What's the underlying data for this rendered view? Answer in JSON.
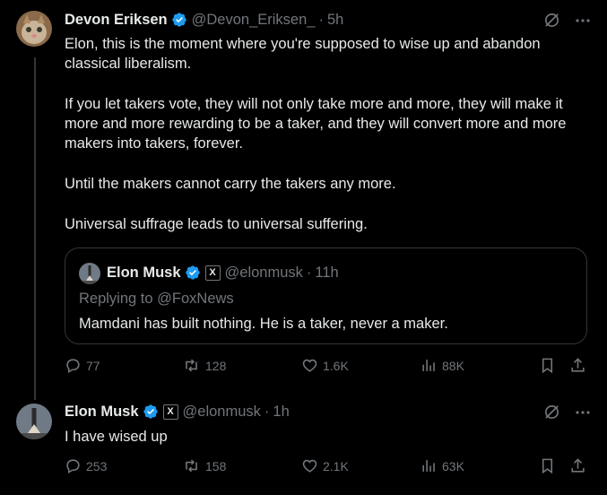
{
  "tweet1": {
    "name": "Devon Eriksen",
    "handle": "@Devon_Eriksen_",
    "separator": "·",
    "time": "5h",
    "paragraphs": [
      "Elon, this is the moment where you're supposed to wise up and abandon classical liberalism.",
      "If you let takers vote, they will not only take more and more, they will make it more and more rewarding to be a taker, and they will convert more and more makers into takers, forever.",
      "Until the makers cannot carry the takers any more.",
      "Universal suffrage leads to universal suffering."
    ],
    "quote": {
      "name": "Elon Musk",
      "x_badge": "X",
      "handle": "@elonmusk",
      "separator": "·",
      "time": "11h",
      "replying_label": "Replying to",
      "replying_to": "@FoxNews",
      "text": "Mamdani has built nothing. He is a taker, never a maker."
    },
    "stats": {
      "replies": "77",
      "reposts": "128",
      "likes": "1.6K",
      "views": "88K"
    }
  },
  "tweet2": {
    "name": "Elon Musk",
    "x_badge": "X",
    "handle": "@elonmusk",
    "separator": "·",
    "time": "1h",
    "text": "I have wised up",
    "stats": {
      "replies": "253",
      "reposts": "158",
      "likes": "2.1K",
      "views": "63K"
    }
  },
  "colors": {
    "background": "#000000",
    "text": "#e7e9ea",
    "muted": "#71767b",
    "border": "#333639",
    "verified": "#1d9bf0"
  },
  "icons": [
    "grok-icon",
    "more-icon",
    "verified-icon",
    "reply-icon",
    "repost-icon",
    "like-icon",
    "views-icon",
    "bookmark-icon",
    "share-icon"
  ]
}
